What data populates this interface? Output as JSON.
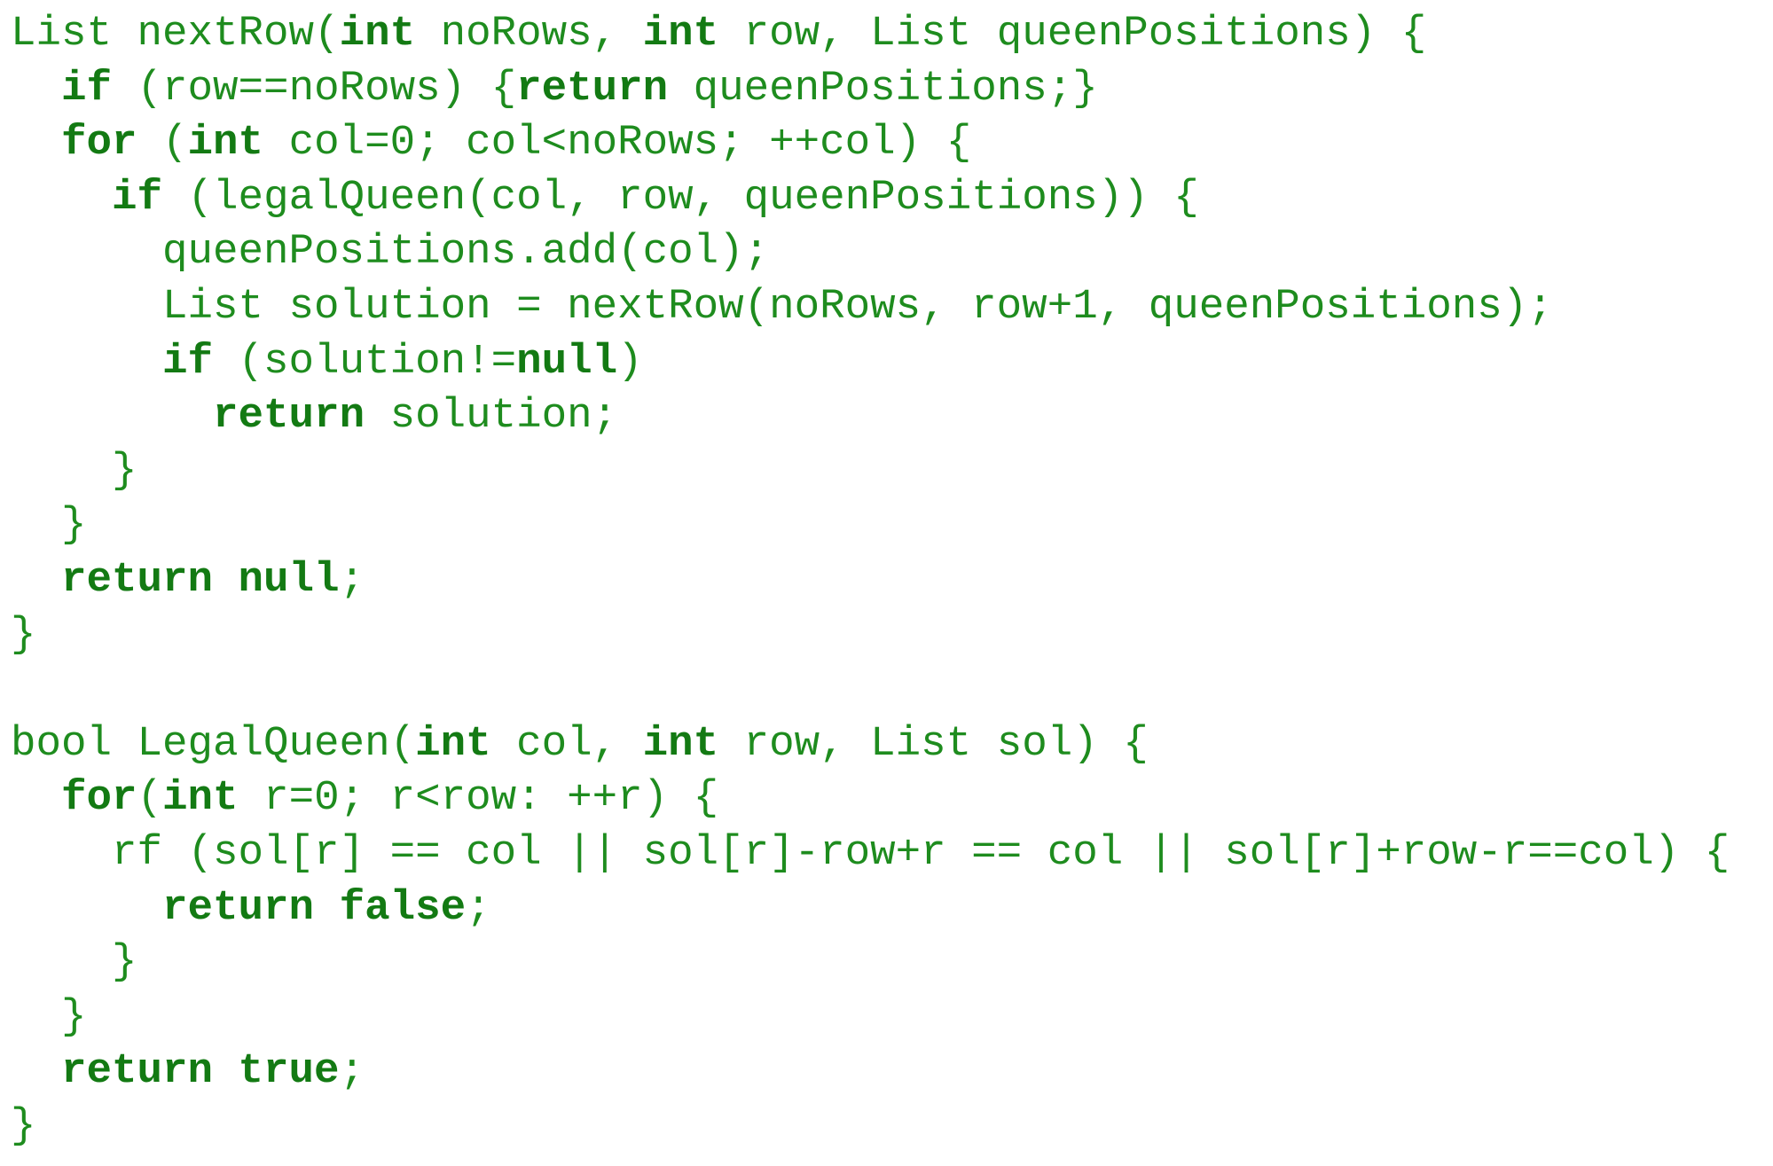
{
  "colors": {
    "code_text": "#1e8c1e",
    "keyword": "#137a13",
    "background": "#ffffff"
  },
  "code_lines": [
    [
      {
        "t": "List nextRow("
      },
      {
        "t": "int",
        "kw": true
      },
      {
        "t": " noRows, "
      },
      {
        "t": "int",
        "kw": true
      },
      {
        "t": " row, List queenPositions) {"
      }
    ],
    [
      {
        "t": "  "
      },
      {
        "t": "if",
        "kw": true
      },
      {
        "t": " (row==noRows) {"
      },
      {
        "t": "return",
        "kw": true
      },
      {
        "t": " queenPositions;}"
      }
    ],
    [
      {
        "t": "  "
      },
      {
        "t": "for",
        "kw": true
      },
      {
        "t": " ("
      },
      {
        "t": "int",
        "kw": true
      },
      {
        "t": " col=0; col<noRows; ++col) {"
      }
    ],
    [
      {
        "t": "    "
      },
      {
        "t": "if",
        "kw": true
      },
      {
        "t": " (legalQueen(col, row, queenPositions)) {"
      }
    ],
    [
      {
        "t": "      queenPositions.add(col);"
      }
    ],
    [
      {
        "t": "      List solution = nextRow(noRows, row+1, queenPositions);"
      }
    ],
    [
      {
        "t": "      "
      },
      {
        "t": "if",
        "kw": true
      },
      {
        "t": " (solution!="
      },
      {
        "t": "null",
        "kw": true
      },
      {
        "t": ")"
      }
    ],
    [
      {
        "t": "        "
      },
      {
        "t": "return",
        "kw": true
      },
      {
        "t": " solution;"
      }
    ],
    [
      {
        "t": "    }"
      }
    ],
    [
      {
        "t": "  }"
      }
    ],
    [
      {
        "t": "  "
      },
      {
        "t": "return null",
        "kw": true
      },
      {
        "t": ";"
      }
    ],
    [
      {
        "t": "}"
      }
    ],
    [],
    [
      {
        "t": "bool LegalQueen("
      },
      {
        "t": "int",
        "kw": true
      },
      {
        "t": " col, "
      },
      {
        "t": "int",
        "kw": true
      },
      {
        "t": " row, List sol) {"
      }
    ],
    [
      {
        "t": "  "
      },
      {
        "t": "for",
        "kw": true
      },
      {
        "t": "("
      },
      {
        "t": "int",
        "kw": true
      },
      {
        "t": " r=0; r<row: ++r) {"
      }
    ],
    [
      {
        "t": "    rf (sol[r] == col || sol[r]-row+r == col || sol[r]+row-r==col) {"
      }
    ],
    [
      {
        "t": "      "
      },
      {
        "t": "return false",
        "kw": true
      },
      {
        "t": ";"
      }
    ],
    [
      {
        "t": "    }"
      }
    ],
    [
      {
        "t": "  }"
      }
    ],
    [
      {
        "t": "  "
      },
      {
        "t": "return true",
        "kw": true
      },
      {
        "t": ";"
      }
    ],
    [
      {
        "t": "}"
      }
    ]
  ]
}
